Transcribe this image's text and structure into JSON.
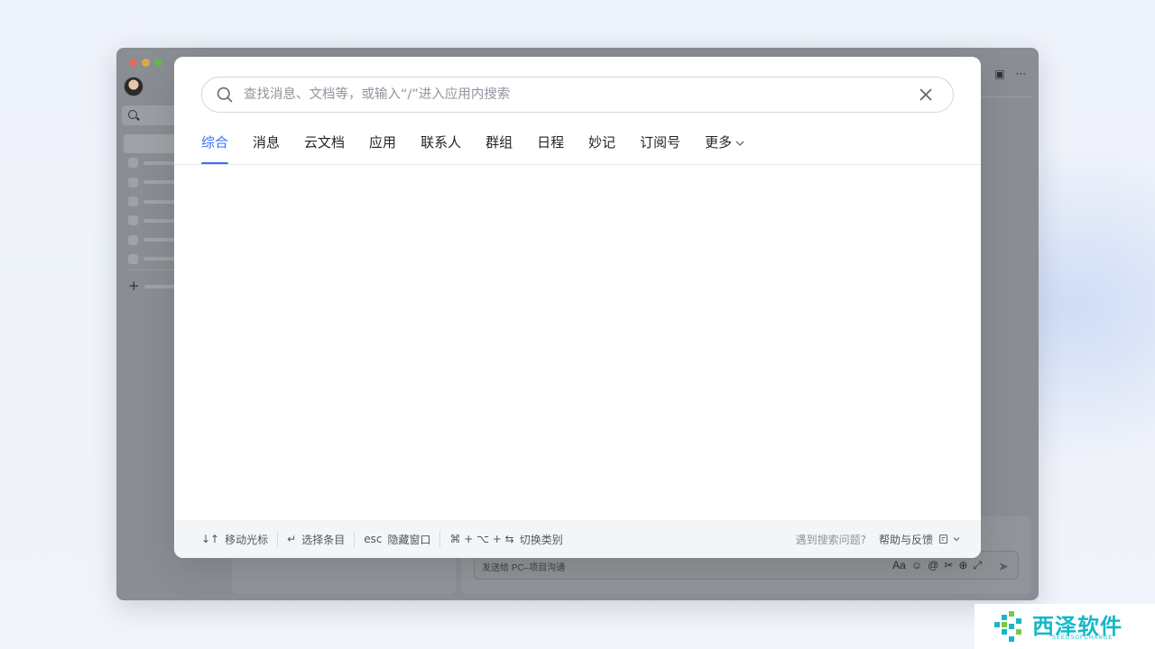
{
  "background_app": {
    "composer_placeholder": "发送给 PC–项目沟通",
    "topbar_icons": [
      "window-icon",
      "more-icon"
    ]
  },
  "search": {
    "placeholder": "查找消息、文档等，或输入“/”进入应用内搜索",
    "value": ""
  },
  "tabs": [
    {
      "label": "综合",
      "active": true
    },
    {
      "label": "消息"
    },
    {
      "label": "云文档"
    },
    {
      "label": "应用"
    },
    {
      "label": "联系人"
    },
    {
      "label": "群组"
    },
    {
      "label": "日程"
    },
    {
      "label": "妙记"
    },
    {
      "label": "订阅号"
    },
    {
      "label": "更多"
    }
  ],
  "footer": {
    "hints": [
      {
        "key": "↓↑",
        "label": "移动光标"
      },
      {
        "key": "↵",
        "label": "选择条目"
      },
      {
        "key": "esc",
        "label": "隐藏窗口"
      },
      {
        "key": "⌘ + ⌥ + ⇆",
        "label": "切换类别"
      }
    ],
    "issue_text": "遇到搜索问题?",
    "help_label": "帮助与反馈"
  },
  "watermark": {
    "brand": "西泽软件",
    "sub": "SEEDSOFCHANGE"
  },
  "colors": {
    "accent": "#3370ff",
    "overlay_window": "#8a8d93",
    "watermark": "#14b8c8"
  }
}
